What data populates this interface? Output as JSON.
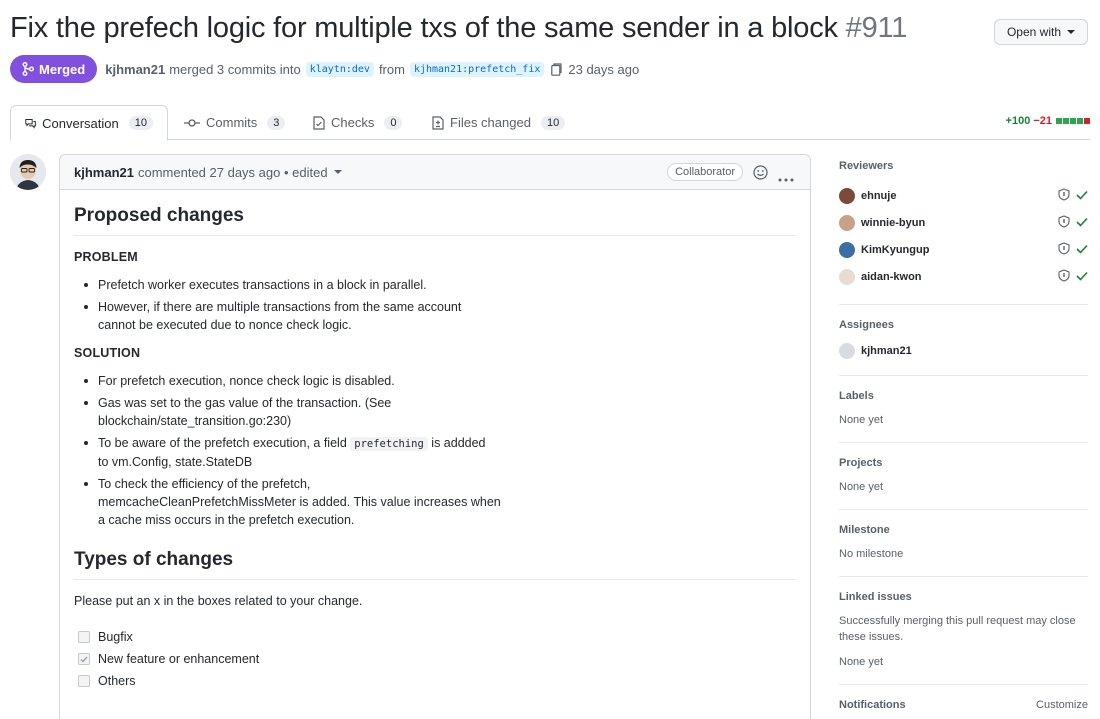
{
  "pr": {
    "title": "Fix the prefech logic for multiple txs of the same sender in a block",
    "number": "#911",
    "open_with": "Open with",
    "state": "Merged",
    "author": "kjhman21",
    "merge_text": "merged 3 commits into",
    "base_branch": "klaytn:dev",
    "from_text": "from",
    "head_branch": "kjhman21:prefetch_fix",
    "time": "23 days ago"
  },
  "tabs": [
    {
      "label": "Conversation",
      "count": "10",
      "icon": "comment-discussion-icon"
    },
    {
      "label": "Commits",
      "count": "3",
      "icon": "git-commit-icon"
    },
    {
      "label": "Checks",
      "count": "0",
      "icon": "checklist-icon"
    },
    {
      "label": "Files changed",
      "count": "10",
      "icon": "file-diff-icon"
    }
  ],
  "diffstat": {
    "additions": "+100",
    "deletions": "−21"
  },
  "comment": {
    "author": "kjhman21",
    "meta": "commented 27 days ago • edited",
    "badge": "Collaborator",
    "heading1": "Proposed changes",
    "problem_label": "PROBLEM",
    "problem_items": [
      "Prefetch worker executes transactions in a block in parallel.",
      "However, if there are multiple transactions from the same account\ncannot be executed due to nonce check logic."
    ],
    "solution_label": "SOLUTION",
    "solution_items": [
      "For prefetch execution, nonce check logic is disabled.",
      "Gas was set to the gas value of the transaction. (See\nblockchain/state_transition.go:230)"
    ],
    "solution_item3_pre": "To be aware of the prefetch execution, a field",
    "solution_item3_code": "prefetching",
    "solution_item3_post": "is addded",
    "solution_item3_line2": "to vm.Config, state.StateDB",
    "solution_item4": "To check the efficiency of the prefetch,\nmemcacheCleanPrefetchMissMeter is added. This value increases when\na cache miss occurs in the prefetch execution.",
    "heading2": "Types of changes",
    "instructions": "Please put an x in the boxes related to your change.",
    "tasks": [
      {
        "label": "Bugfix",
        "checked": false
      },
      {
        "label": "New feature or enhancement",
        "checked": true
      },
      {
        "label": "Others",
        "checked": false
      }
    ]
  },
  "sidebar": {
    "reviewers_title": "Reviewers",
    "reviewers": [
      {
        "name": "ehnuje",
        "color": "#7a4a3a"
      },
      {
        "name": "winnie-byun",
        "color": "#c9a08a"
      },
      {
        "name": "KimKyungup",
        "color": "#3b6ea5"
      },
      {
        "name": "aidan-kwon",
        "color": "#e8dcd0"
      }
    ],
    "assignees_title": "Assignees",
    "assignee": "kjhman21",
    "labels_title": "Labels",
    "labels_value": "None yet",
    "projects_title": "Projects",
    "projects_value": "None yet",
    "milestone_title": "Milestone",
    "milestone_value": "No milestone",
    "linked_title": "Linked issues",
    "linked_desc": "Successfully merging this pull request may close these issues.",
    "linked_value": "None yet",
    "notifications_title": "Notifications",
    "customize": "Customize"
  }
}
